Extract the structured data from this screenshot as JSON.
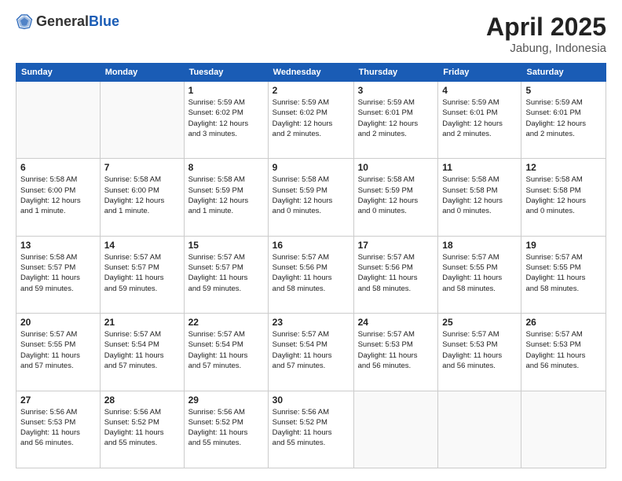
{
  "header": {
    "logo_general": "General",
    "logo_blue": "Blue",
    "title": "April 2025",
    "location": "Jabung, Indonesia"
  },
  "days_of_week": [
    "Sunday",
    "Monday",
    "Tuesday",
    "Wednesday",
    "Thursday",
    "Friday",
    "Saturday"
  ],
  "weeks": [
    [
      {
        "day": "",
        "detail": ""
      },
      {
        "day": "",
        "detail": ""
      },
      {
        "day": "1",
        "detail": "Sunrise: 5:59 AM\nSunset: 6:02 PM\nDaylight: 12 hours\nand 3 minutes."
      },
      {
        "day": "2",
        "detail": "Sunrise: 5:59 AM\nSunset: 6:02 PM\nDaylight: 12 hours\nand 2 minutes."
      },
      {
        "day": "3",
        "detail": "Sunrise: 5:59 AM\nSunset: 6:01 PM\nDaylight: 12 hours\nand 2 minutes."
      },
      {
        "day": "4",
        "detail": "Sunrise: 5:59 AM\nSunset: 6:01 PM\nDaylight: 12 hours\nand 2 minutes."
      },
      {
        "day": "5",
        "detail": "Sunrise: 5:59 AM\nSunset: 6:01 PM\nDaylight: 12 hours\nand 2 minutes."
      }
    ],
    [
      {
        "day": "6",
        "detail": "Sunrise: 5:58 AM\nSunset: 6:00 PM\nDaylight: 12 hours\nand 1 minute."
      },
      {
        "day": "7",
        "detail": "Sunrise: 5:58 AM\nSunset: 6:00 PM\nDaylight: 12 hours\nand 1 minute."
      },
      {
        "day": "8",
        "detail": "Sunrise: 5:58 AM\nSunset: 5:59 PM\nDaylight: 12 hours\nand 1 minute."
      },
      {
        "day": "9",
        "detail": "Sunrise: 5:58 AM\nSunset: 5:59 PM\nDaylight: 12 hours\nand 0 minutes."
      },
      {
        "day": "10",
        "detail": "Sunrise: 5:58 AM\nSunset: 5:59 PM\nDaylight: 12 hours\nand 0 minutes."
      },
      {
        "day": "11",
        "detail": "Sunrise: 5:58 AM\nSunset: 5:58 PM\nDaylight: 12 hours\nand 0 minutes."
      },
      {
        "day": "12",
        "detail": "Sunrise: 5:58 AM\nSunset: 5:58 PM\nDaylight: 12 hours\nand 0 minutes."
      }
    ],
    [
      {
        "day": "13",
        "detail": "Sunrise: 5:58 AM\nSunset: 5:57 PM\nDaylight: 11 hours\nand 59 minutes."
      },
      {
        "day": "14",
        "detail": "Sunrise: 5:57 AM\nSunset: 5:57 PM\nDaylight: 11 hours\nand 59 minutes."
      },
      {
        "day": "15",
        "detail": "Sunrise: 5:57 AM\nSunset: 5:57 PM\nDaylight: 11 hours\nand 59 minutes."
      },
      {
        "day": "16",
        "detail": "Sunrise: 5:57 AM\nSunset: 5:56 PM\nDaylight: 11 hours\nand 58 minutes."
      },
      {
        "day": "17",
        "detail": "Sunrise: 5:57 AM\nSunset: 5:56 PM\nDaylight: 11 hours\nand 58 minutes."
      },
      {
        "day": "18",
        "detail": "Sunrise: 5:57 AM\nSunset: 5:55 PM\nDaylight: 11 hours\nand 58 minutes."
      },
      {
        "day": "19",
        "detail": "Sunrise: 5:57 AM\nSunset: 5:55 PM\nDaylight: 11 hours\nand 58 minutes."
      }
    ],
    [
      {
        "day": "20",
        "detail": "Sunrise: 5:57 AM\nSunset: 5:55 PM\nDaylight: 11 hours\nand 57 minutes."
      },
      {
        "day": "21",
        "detail": "Sunrise: 5:57 AM\nSunset: 5:54 PM\nDaylight: 11 hours\nand 57 minutes."
      },
      {
        "day": "22",
        "detail": "Sunrise: 5:57 AM\nSunset: 5:54 PM\nDaylight: 11 hours\nand 57 minutes."
      },
      {
        "day": "23",
        "detail": "Sunrise: 5:57 AM\nSunset: 5:54 PM\nDaylight: 11 hours\nand 57 minutes."
      },
      {
        "day": "24",
        "detail": "Sunrise: 5:57 AM\nSunset: 5:53 PM\nDaylight: 11 hours\nand 56 minutes."
      },
      {
        "day": "25",
        "detail": "Sunrise: 5:57 AM\nSunset: 5:53 PM\nDaylight: 11 hours\nand 56 minutes."
      },
      {
        "day": "26",
        "detail": "Sunrise: 5:57 AM\nSunset: 5:53 PM\nDaylight: 11 hours\nand 56 minutes."
      }
    ],
    [
      {
        "day": "27",
        "detail": "Sunrise: 5:56 AM\nSunset: 5:53 PM\nDaylight: 11 hours\nand 56 minutes."
      },
      {
        "day": "28",
        "detail": "Sunrise: 5:56 AM\nSunset: 5:52 PM\nDaylight: 11 hours\nand 55 minutes."
      },
      {
        "day": "29",
        "detail": "Sunrise: 5:56 AM\nSunset: 5:52 PM\nDaylight: 11 hours\nand 55 minutes."
      },
      {
        "day": "30",
        "detail": "Sunrise: 5:56 AM\nSunset: 5:52 PM\nDaylight: 11 hours\nand 55 minutes."
      },
      {
        "day": "",
        "detail": ""
      },
      {
        "day": "",
        "detail": ""
      },
      {
        "day": "",
        "detail": ""
      }
    ]
  ]
}
